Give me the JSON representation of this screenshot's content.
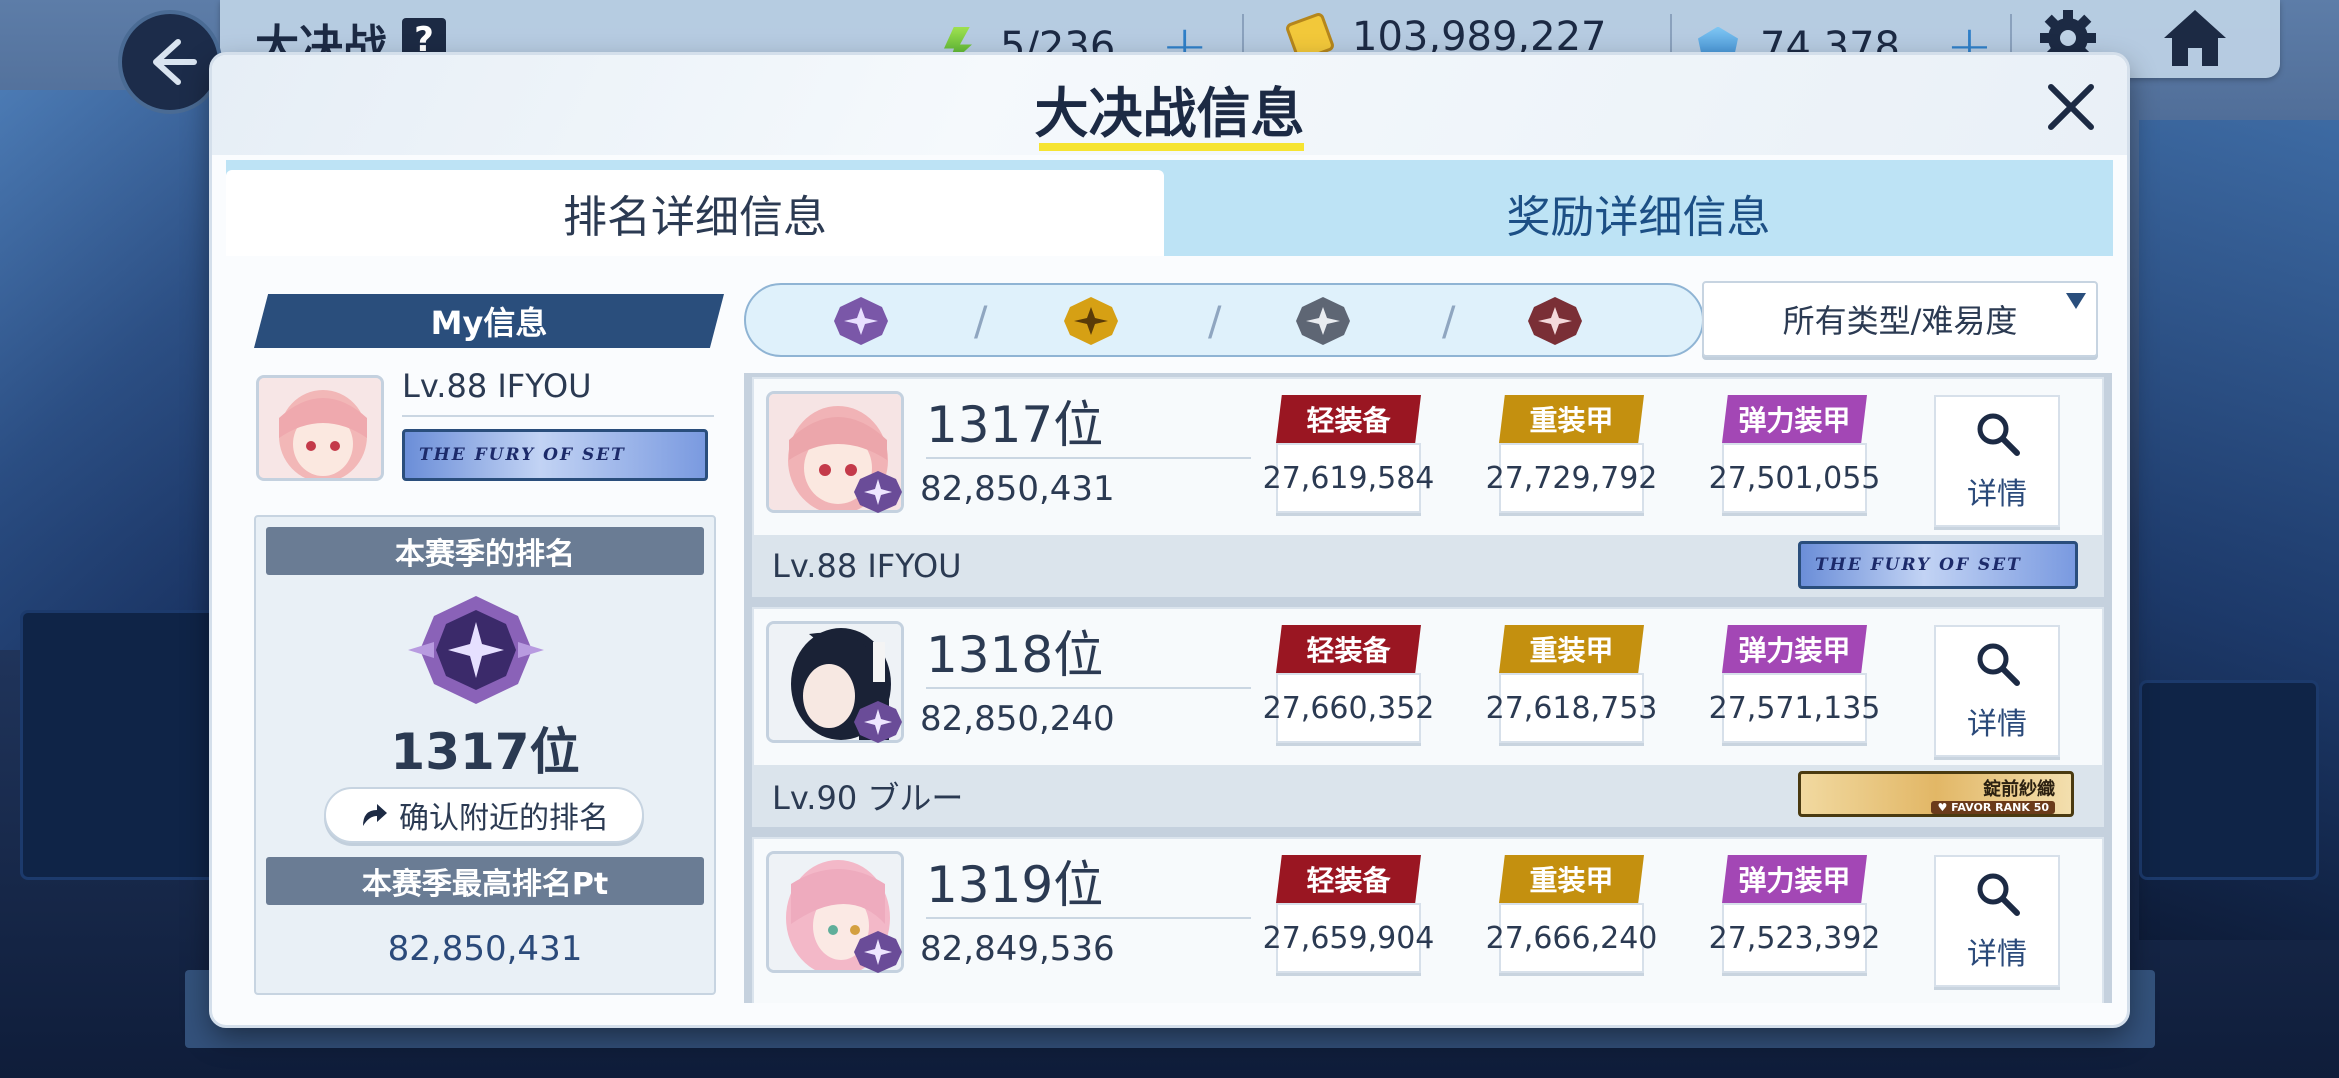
{
  "topbar": {
    "title": "大决战",
    "help": "?",
    "energy": "5/236",
    "credits": "103,989,227",
    "gems": "74,378",
    "plus": "+"
  },
  "modal": {
    "title": "大决战信息",
    "tabs": [
      "排名详细信息",
      "奖励详细信息"
    ]
  },
  "my_info": {
    "header": "My信息",
    "name": "Lv.88  IFYOU",
    "banner_text": "THE FURY OF SET",
    "season_rank_label": "本赛季的排名",
    "season_rank": "1317位",
    "nearby_button": "确认附近的排名",
    "best_pt_label": "本赛季最高排名Pt",
    "best_pt": "82,850,431"
  },
  "filter": {
    "type_select": "所有类型/难易度",
    "sep": "/"
  },
  "armor_labels": [
    "轻装备",
    "重装甲",
    "弹力装甲"
  ],
  "detail_label": "详情",
  "entries": [
    {
      "rank": "1317位",
      "score": "82,850,431",
      "light": "27,619,584",
      "heavy": "27,729,792",
      "special": "27,501,055",
      "name": "Lv.88  IFYOU",
      "banner": "THE FURY OF SET"
    },
    {
      "rank": "1318位",
      "score": "82,850,240",
      "light": "27,660,352",
      "heavy": "27,618,753",
      "special": "27,571,135",
      "name": "Lv.90  ブルー",
      "banner": "錠前紗織",
      "banner_sub": "♥ FAVOR RANK 50"
    },
    {
      "rank": "1319位",
      "score": "82,849,536",
      "light": "27,659,904",
      "heavy": "27,666,240",
      "special": "27,523,392"
    }
  ],
  "colors": {
    "light_armor": "#9a1622",
    "heavy_armor": "#c4900f",
    "special_armor": "#a347b5",
    "accent_underline": "#f6e432"
  },
  "icons": [
    "back-arrow-icon",
    "energy-icon",
    "credit-icon",
    "gem-icon",
    "gear-icon",
    "home-icon",
    "close-icon",
    "magnifier-icon",
    "share-arrow-icon",
    "rank-emblem-icon"
  ]
}
